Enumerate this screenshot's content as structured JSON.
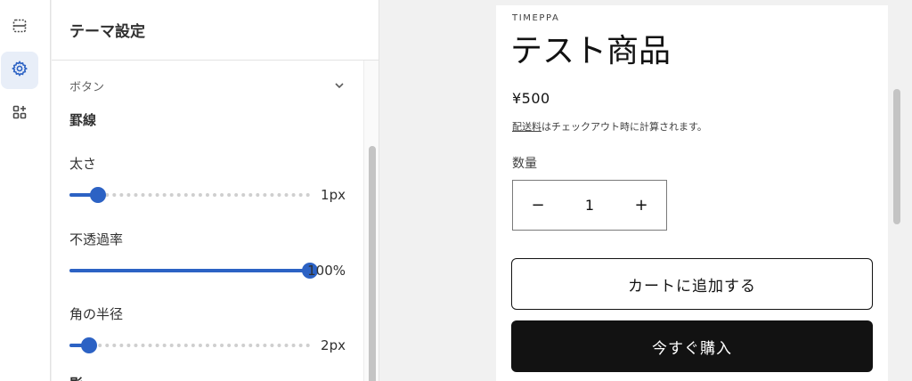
{
  "rail": {
    "items": [
      {
        "icon": "sections-icon",
        "active": false
      },
      {
        "icon": "gear-icon",
        "active": true
      },
      {
        "icon": "apps-add-icon",
        "active": false
      }
    ]
  },
  "panel": {
    "title": "テーマ設定",
    "section": "ボタン",
    "group_title": "罫線",
    "fields": [
      {
        "label": "太さ",
        "value_text": "1px",
        "level": 0.12
      },
      {
        "label": "不透過率",
        "value_text": "100%",
        "level": 1.0
      },
      {
        "label": "角の半径",
        "value_text": "2px",
        "level": 0.08
      }
    ],
    "next_group_cut": "影"
  },
  "preview": {
    "vendor": "TIMEPPA",
    "title": "テスト商品",
    "price": "¥500",
    "shipping_link": "配送料",
    "shipping_rest": "はチェックアウト時に計算されます。",
    "quantity_label": "数量",
    "quantity_minus": "−",
    "quantity_value": "1",
    "quantity_plus": "+",
    "add_to_cart": "カートに追加する",
    "buy_now": "今すぐ購入"
  },
  "colors": {
    "accent": "#2c62c4",
    "buy_button": "#121212"
  }
}
